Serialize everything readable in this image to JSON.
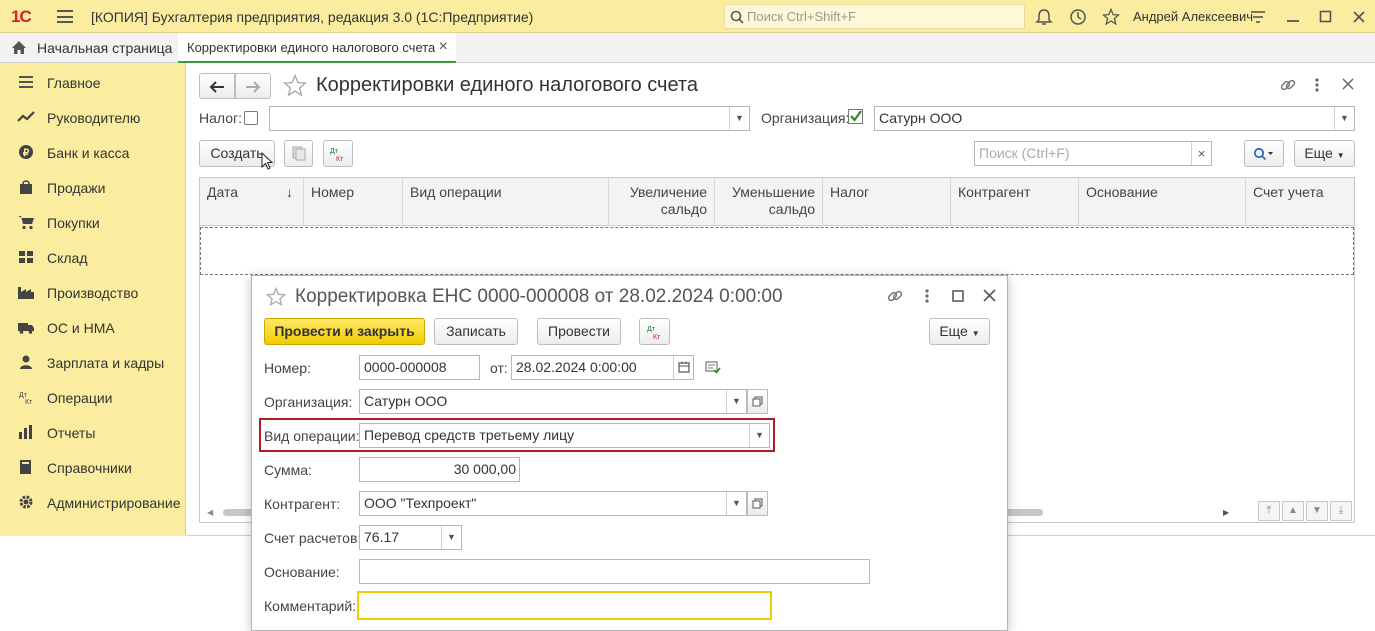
{
  "app": {
    "logo": "1С",
    "title": "[КОПИЯ] Бухгалтерия предприятия, редакция 3.0  (1С:Предприятие)",
    "search_placeholder": "Поиск Ctrl+Shift+F",
    "user": "Андрей Алексеевич"
  },
  "tabs": {
    "home": "Начальная страница",
    "active": "Корректировки единого налогового счета",
    "close": "×"
  },
  "sidebar": {
    "items": [
      {
        "label": "Главное",
        "icon": "menu-icon"
      },
      {
        "label": "Руководителю",
        "icon": "chart-line-icon"
      },
      {
        "label": "Банк и касса",
        "icon": "coin-icon"
      },
      {
        "label": "Продажи",
        "icon": "bag-icon"
      },
      {
        "label": "Покупки",
        "icon": "cart-icon"
      },
      {
        "label": "Склад",
        "icon": "warehouse-icon"
      },
      {
        "label": "Производство",
        "icon": "factory-icon"
      },
      {
        "label": "ОС и НМА",
        "icon": "truck-icon"
      },
      {
        "label": "Зарплата и кадры",
        "icon": "person-icon"
      },
      {
        "label": "Операции",
        "icon": "dt-kt-icon"
      },
      {
        "label": "Отчеты",
        "icon": "bar-chart-icon"
      },
      {
        "label": "Справочники",
        "icon": "book-icon"
      },
      {
        "label": "Администрирование",
        "icon": "gear-icon"
      }
    ]
  },
  "list": {
    "title": "Корректировки единого налогового счета",
    "tax_label": "Налог:",
    "org_label": "Организация:",
    "org_value": "Сатурн ООО",
    "create_button": "Создать",
    "search_placeholder": "Поиск (Ctrl+F)",
    "more_button": "Еще",
    "columns": [
      {
        "label": "Дата"
      },
      {
        "label": "Номер"
      },
      {
        "label": "Вид операции"
      },
      {
        "label_line1": "Увеличение",
        "label_line2": "сальдо"
      },
      {
        "label_line1": "Уменьшение",
        "label_line2": "сальдо"
      },
      {
        "label": "Налог"
      },
      {
        "label": "Контрагент"
      },
      {
        "label": "Основание"
      },
      {
        "label": "Счет учета"
      }
    ],
    "sort_arrow": "↓"
  },
  "dialog": {
    "title": "Корректировка ЕНС 0000-000008 от 28.02.2024 0:00:00",
    "btn_post_close": "Провести и закрыть",
    "btn_save": "Записать",
    "btn_post": "Провести",
    "btn_more": "Еще",
    "dtkt": {
      "dt": "Дт",
      "kt": "Кт"
    },
    "number_label": "Номер:",
    "number_value": "0000-000008",
    "date_label": "от:",
    "date_value": "28.02.2024  0:00:00",
    "org_label": "Организация:",
    "org_value": "Сатурн ООО",
    "op_label": "Вид операции:",
    "op_value": "Перевод средств третьему лицу",
    "sum_label": "Сумма:",
    "sum_value": "30 000,00",
    "contractor_label": "Контрагент:",
    "contractor_value": "ООО \"Техпроект\"",
    "account_label": "Счет расчетов:",
    "account_value": "76.17",
    "basis_label": "Основание:",
    "basis_value": "",
    "comment_label": "Комментарий:",
    "comment_value": ""
  },
  "colors": {
    "yellow_panel": "#fbeda0",
    "accent_yellow": "#f2cc00",
    "highlight_red": "#b01d24",
    "tab_green": "#3b9b3b",
    "check_green": "#2e8b2e"
  }
}
